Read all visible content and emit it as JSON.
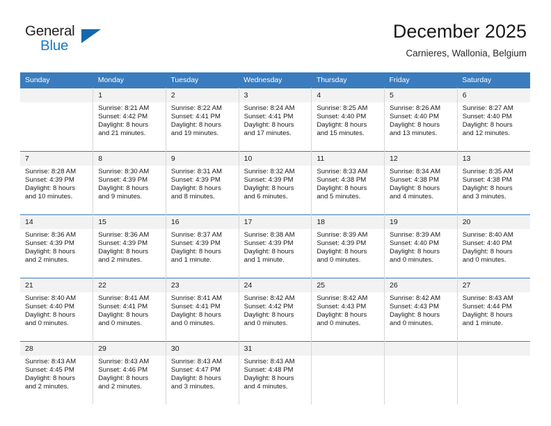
{
  "logo": {
    "word_one": "General",
    "word_two": "Blue",
    "triangle_icon": "triangle-icon"
  },
  "header": {
    "title": "December 2025",
    "subtitle": "Carnieres, Wallonia, Belgium"
  },
  "colors": {
    "header_blue": "#3a7cbe",
    "logo_blue": "#1c7ac0",
    "daynum_bg": "#f2f2f2",
    "cell_border": "#d6d6d6"
  },
  "weekday_headers": [
    "Sunday",
    "Monday",
    "Tuesday",
    "Wednesday",
    "Thursday",
    "Friday",
    "Saturday"
  ],
  "weeks": [
    [
      {
        "day": "",
        "sunrise": "",
        "sunset": "",
        "daylight_1": "",
        "daylight_2": ""
      },
      {
        "day": "1",
        "sunrise": "Sunrise: 8:21 AM",
        "sunset": "Sunset: 4:42 PM",
        "daylight_1": "Daylight: 8 hours",
        "daylight_2": "and 21 minutes."
      },
      {
        "day": "2",
        "sunrise": "Sunrise: 8:22 AM",
        "sunset": "Sunset: 4:41 PM",
        "daylight_1": "Daylight: 8 hours",
        "daylight_2": "and 19 minutes."
      },
      {
        "day": "3",
        "sunrise": "Sunrise: 8:24 AM",
        "sunset": "Sunset: 4:41 PM",
        "daylight_1": "Daylight: 8 hours",
        "daylight_2": "and 17 minutes."
      },
      {
        "day": "4",
        "sunrise": "Sunrise: 8:25 AM",
        "sunset": "Sunset: 4:40 PM",
        "daylight_1": "Daylight: 8 hours",
        "daylight_2": "and 15 minutes."
      },
      {
        "day": "5",
        "sunrise": "Sunrise: 8:26 AM",
        "sunset": "Sunset: 4:40 PM",
        "daylight_1": "Daylight: 8 hours",
        "daylight_2": "and 13 minutes."
      },
      {
        "day": "6",
        "sunrise": "Sunrise: 8:27 AM",
        "sunset": "Sunset: 4:40 PM",
        "daylight_1": "Daylight: 8 hours",
        "daylight_2": "and 12 minutes."
      }
    ],
    [
      {
        "day": "7",
        "sunrise": "Sunrise: 8:28 AM",
        "sunset": "Sunset: 4:39 PM",
        "daylight_1": "Daylight: 8 hours",
        "daylight_2": "and 10 minutes."
      },
      {
        "day": "8",
        "sunrise": "Sunrise: 8:30 AM",
        "sunset": "Sunset: 4:39 PM",
        "daylight_1": "Daylight: 8 hours",
        "daylight_2": "and 9 minutes."
      },
      {
        "day": "9",
        "sunrise": "Sunrise: 8:31 AM",
        "sunset": "Sunset: 4:39 PM",
        "daylight_1": "Daylight: 8 hours",
        "daylight_2": "and 8 minutes."
      },
      {
        "day": "10",
        "sunrise": "Sunrise: 8:32 AM",
        "sunset": "Sunset: 4:39 PM",
        "daylight_1": "Daylight: 8 hours",
        "daylight_2": "and 6 minutes."
      },
      {
        "day": "11",
        "sunrise": "Sunrise: 8:33 AM",
        "sunset": "Sunset: 4:38 PM",
        "daylight_1": "Daylight: 8 hours",
        "daylight_2": "and 5 minutes."
      },
      {
        "day": "12",
        "sunrise": "Sunrise: 8:34 AM",
        "sunset": "Sunset: 4:38 PM",
        "daylight_1": "Daylight: 8 hours",
        "daylight_2": "and 4 minutes."
      },
      {
        "day": "13",
        "sunrise": "Sunrise: 8:35 AM",
        "sunset": "Sunset: 4:38 PM",
        "daylight_1": "Daylight: 8 hours",
        "daylight_2": "and 3 minutes."
      }
    ],
    [
      {
        "day": "14",
        "sunrise": "Sunrise: 8:36 AM",
        "sunset": "Sunset: 4:39 PM",
        "daylight_1": "Daylight: 8 hours",
        "daylight_2": "and 2 minutes."
      },
      {
        "day": "15",
        "sunrise": "Sunrise: 8:36 AM",
        "sunset": "Sunset: 4:39 PM",
        "daylight_1": "Daylight: 8 hours",
        "daylight_2": "and 2 minutes."
      },
      {
        "day": "16",
        "sunrise": "Sunrise: 8:37 AM",
        "sunset": "Sunset: 4:39 PM",
        "daylight_1": "Daylight: 8 hours",
        "daylight_2": "and 1 minute."
      },
      {
        "day": "17",
        "sunrise": "Sunrise: 8:38 AM",
        "sunset": "Sunset: 4:39 PM",
        "daylight_1": "Daylight: 8 hours",
        "daylight_2": "and 1 minute."
      },
      {
        "day": "18",
        "sunrise": "Sunrise: 8:39 AM",
        "sunset": "Sunset: 4:39 PM",
        "daylight_1": "Daylight: 8 hours",
        "daylight_2": "and 0 minutes."
      },
      {
        "day": "19",
        "sunrise": "Sunrise: 8:39 AM",
        "sunset": "Sunset: 4:40 PM",
        "daylight_1": "Daylight: 8 hours",
        "daylight_2": "and 0 minutes."
      },
      {
        "day": "20",
        "sunrise": "Sunrise: 8:40 AM",
        "sunset": "Sunset: 4:40 PM",
        "daylight_1": "Daylight: 8 hours",
        "daylight_2": "and 0 minutes."
      }
    ],
    [
      {
        "day": "21",
        "sunrise": "Sunrise: 8:40 AM",
        "sunset": "Sunset: 4:40 PM",
        "daylight_1": "Daylight: 8 hours",
        "daylight_2": "and 0 minutes."
      },
      {
        "day": "22",
        "sunrise": "Sunrise: 8:41 AM",
        "sunset": "Sunset: 4:41 PM",
        "daylight_1": "Daylight: 8 hours",
        "daylight_2": "and 0 minutes."
      },
      {
        "day": "23",
        "sunrise": "Sunrise: 8:41 AM",
        "sunset": "Sunset: 4:41 PM",
        "daylight_1": "Daylight: 8 hours",
        "daylight_2": "and 0 minutes."
      },
      {
        "day": "24",
        "sunrise": "Sunrise: 8:42 AM",
        "sunset": "Sunset: 4:42 PM",
        "daylight_1": "Daylight: 8 hours",
        "daylight_2": "and 0 minutes."
      },
      {
        "day": "25",
        "sunrise": "Sunrise: 8:42 AM",
        "sunset": "Sunset: 4:43 PM",
        "daylight_1": "Daylight: 8 hours",
        "daylight_2": "and 0 minutes."
      },
      {
        "day": "26",
        "sunrise": "Sunrise: 8:42 AM",
        "sunset": "Sunset: 4:43 PM",
        "daylight_1": "Daylight: 8 hours",
        "daylight_2": "and 0 minutes."
      },
      {
        "day": "27",
        "sunrise": "Sunrise: 8:43 AM",
        "sunset": "Sunset: 4:44 PM",
        "daylight_1": "Daylight: 8 hours",
        "daylight_2": "and 1 minute."
      }
    ],
    [
      {
        "day": "28",
        "sunrise": "Sunrise: 8:43 AM",
        "sunset": "Sunset: 4:45 PM",
        "daylight_1": "Daylight: 8 hours",
        "daylight_2": "and 2 minutes."
      },
      {
        "day": "29",
        "sunrise": "Sunrise: 8:43 AM",
        "sunset": "Sunset: 4:46 PM",
        "daylight_1": "Daylight: 8 hours",
        "daylight_2": "and 2 minutes."
      },
      {
        "day": "30",
        "sunrise": "Sunrise: 8:43 AM",
        "sunset": "Sunset: 4:47 PM",
        "daylight_1": "Daylight: 8 hours",
        "daylight_2": "and 3 minutes."
      },
      {
        "day": "31",
        "sunrise": "Sunrise: 8:43 AM",
        "sunset": "Sunset: 4:48 PM",
        "daylight_1": "Daylight: 8 hours",
        "daylight_2": "and 4 minutes."
      },
      {
        "day": "",
        "sunrise": "",
        "sunset": "",
        "daylight_1": "",
        "daylight_2": ""
      },
      {
        "day": "",
        "sunrise": "",
        "sunset": "",
        "daylight_1": "",
        "daylight_2": ""
      },
      {
        "day": "",
        "sunrise": "",
        "sunset": "",
        "daylight_1": "",
        "daylight_2": ""
      }
    ]
  ]
}
